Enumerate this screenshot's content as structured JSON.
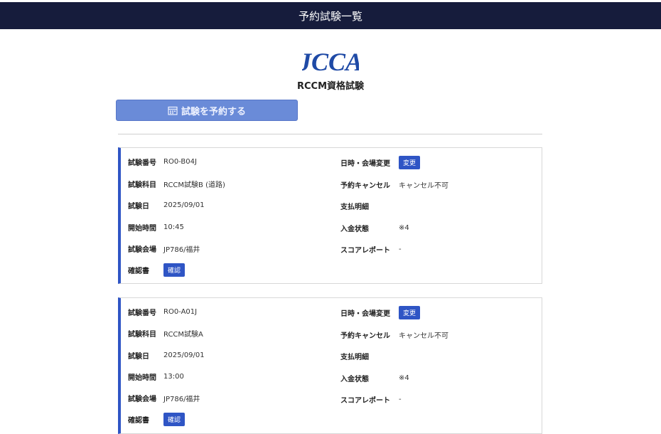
{
  "header": {
    "title": "予約試験一覧"
  },
  "logo": {
    "mark_text": "JCCA",
    "subtitle": "RCCM資格試験"
  },
  "reserve_button": {
    "label": "試験を予約する",
    "icon": "calendar-icon"
  },
  "labels": {
    "exam_number": "試験番号",
    "exam_subject": "試験科目",
    "exam_date": "試験日",
    "start_time": "開始時間",
    "venue": "試験会場",
    "confirmation": "確認書",
    "datetime_change": "日時・会場変更",
    "cancel": "予約キャンセル",
    "payment_detail": "支払明細",
    "payment_status": "入金状態",
    "score_report": "スコアレポート",
    "change_button": "変更",
    "confirm_button": "確認"
  },
  "colors": {
    "header_bg": "#161c3c",
    "accent": "#2f55c5",
    "reserve_button_bg": "#6a8bd8"
  },
  "cards": [
    {
      "exam_number": "RO0-B04J",
      "exam_subject": "RCCM試験B (道路)",
      "exam_date": "2025/09/01",
      "start_time": "10:45",
      "venue": "JP786/福井",
      "cancel": "キャンセル不可",
      "payment_detail": "",
      "payment_status": "※4",
      "score_report": "-"
    },
    {
      "exam_number": "RO0-A01J",
      "exam_subject": "RCCM試験A",
      "exam_date": "2025/09/01",
      "start_time": "13:00",
      "venue": "JP786/福井",
      "cancel": "キャンセル不可",
      "payment_detail": "",
      "payment_status": "※4",
      "score_report": "-"
    }
  ]
}
